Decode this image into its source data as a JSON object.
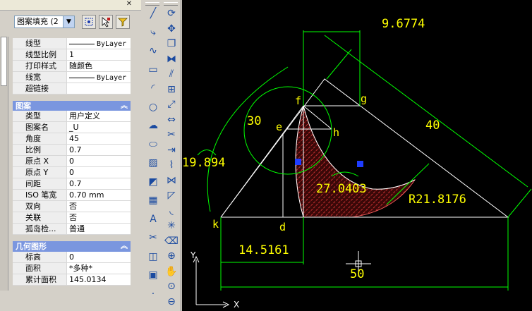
{
  "selector": {
    "value": "图案填充 (2",
    "arrow": "▼"
  },
  "general_rows": [
    {
      "key": "线型",
      "value": "ByLayer",
      "line": true
    },
    {
      "key": "线型比例",
      "value": "1"
    },
    {
      "key": "打印样式",
      "value": "随颜色"
    },
    {
      "key": "线宽",
      "value": "ByLayer",
      "line": true
    },
    {
      "key": "超链接",
      "value": ""
    }
  ],
  "pattern_section": {
    "title": "图案",
    "rows": [
      {
        "key": "类型",
        "value": "用户定义"
      },
      {
        "key": "图案名",
        "value": "_U"
      },
      {
        "key": "角度",
        "value": "45"
      },
      {
        "key": "比例",
        "value": "0.7"
      },
      {
        "key": "原点 X",
        "value": "0"
      },
      {
        "key": "原点 Y",
        "value": "0"
      },
      {
        "key": "间距",
        "value": "0.7"
      },
      {
        "key": "ISO 笔宽",
        "value": "0.70 mm"
      },
      {
        "key": "双向",
        "value": "否"
      },
      {
        "key": "关联",
        "value": "否"
      },
      {
        "key": "孤岛检...",
        "value": "普通"
      }
    ]
  },
  "geometry_section": {
    "title": "几何图形",
    "rows": [
      {
        "key": "标高",
        "value": "0"
      },
      {
        "key": "面积",
        "value": "*多种*"
      },
      {
        "key": "累计面积",
        "value": "145.0134"
      }
    ]
  },
  "drawing": {
    "dims": {
      "top": "9.6774",
      "right_slope": "40",
      "left_arc": "19.894",
      "circle": "30",
      "arc_angle": "27.0403",
      "radius": "R21.8176",
      "bottom_left": "14.5161",
      "bottom_total": "50"
    },
    "points": {
      "f": "f",
      "g": "g",
      "e": "e",
      "h": "h",
      "k": "k",
      "d": "d"
    },
    "ucs": {
      "x": "X",
      "y": "Y"
    },
    "colors": {
      "bg": "#000000",
      "line": "#ffffff",
      "dim": "#00ff00",
      "text": "#ffff00",
      "hatch": "#ff4040",
      "grip": "#1e3cff"
    }
  }
}
